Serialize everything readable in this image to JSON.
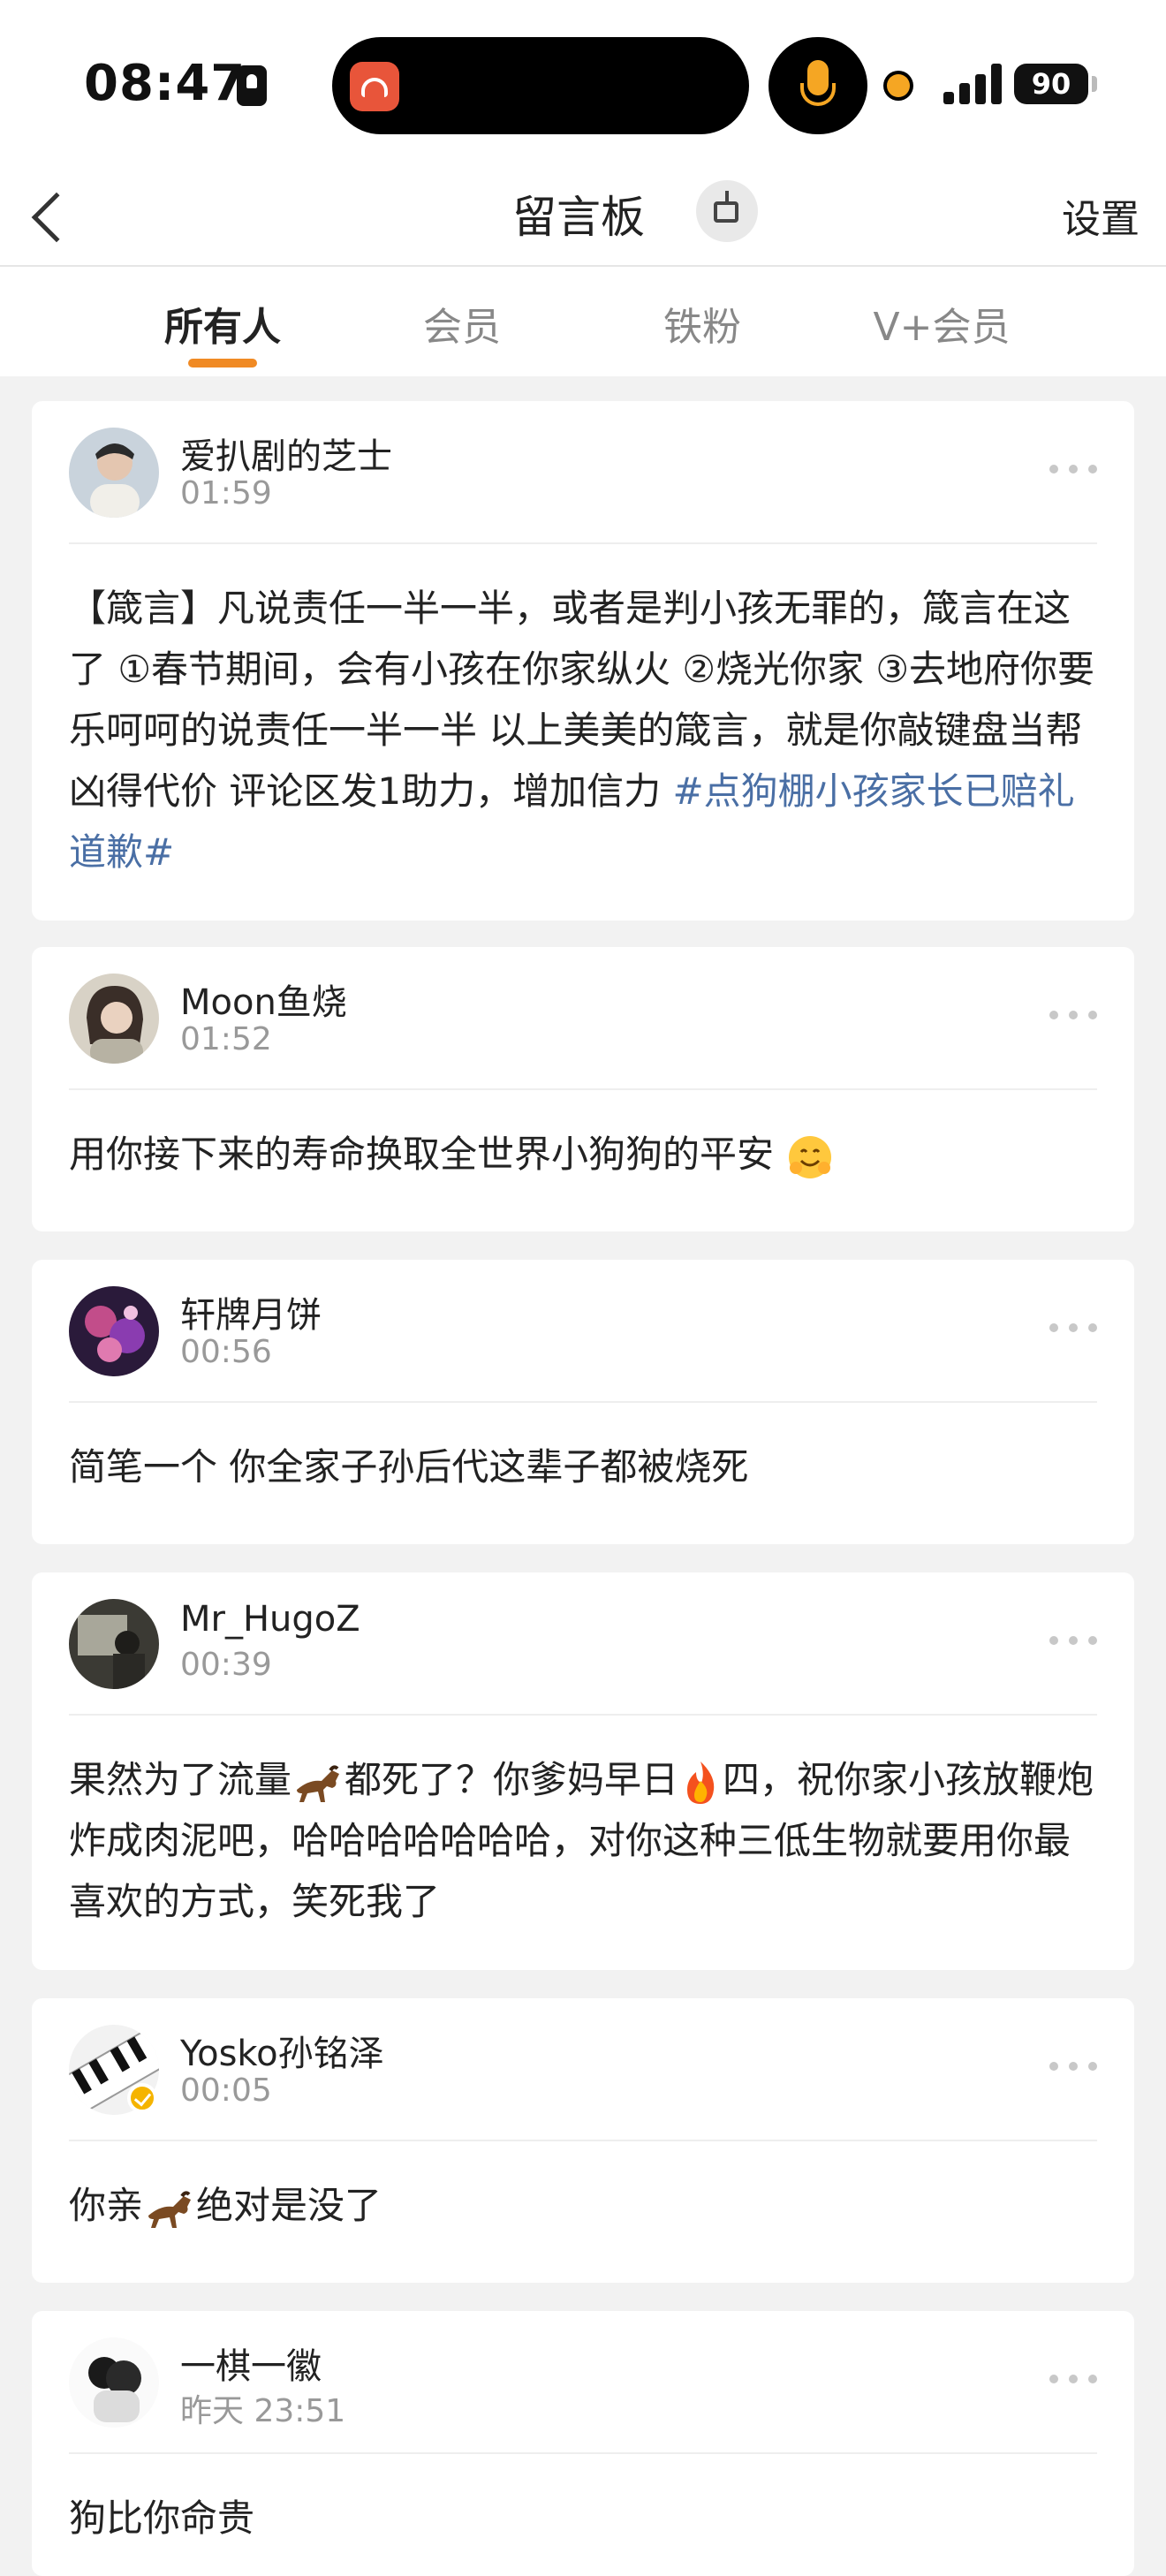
{
  "status_bar": {
    "time": "08:47",
    "battery": "90",
    "icons": [
      "lock-icon",
      "app-icon",
      "mic-icon",
      "recording-dot-icon",
      "signal-icon",
      "battery-icon"
    ]
  },
  "nav": {
    "title": "留言板",
    "settings_label": "设置",
    "icons": [
      "back-icon",
      "broom-icon"
    ]
  },
  "tabs": [
    {
      "label": "所有人",
      "active": true
    },
    {
      "label": "会员",
      "active": false
    },
    {
      "label": "铁粉",
      "active": false
    },
    {
      "label": "V+会员",
      "active": false
    }
  ],
  "colors": {
    "accent": "#f08a24",
    "hashtag": "#4a6fa5",
    "background": "#f2f2f2"
  },
  "comments": [
    {
      "username": "爱扒剧的芝士",
      "time": "01:59",
      "text": "【箴言】凡说责任一半一半，或者是判小孩无罪的，箴言在这了 ①春节期间，会有小孩在你家纵火 ②烧光你家 ③去地府你要乐呵呵的说责任一半一半 以上美美的箴言，就是你敲键盘当帮凶得代价 评论区发1助力，增加信力 ",
      "hashtag": "#点狗棚小孩家长已赔礼道歉#"
    },
    {
      "username": "Moon鱼烧",
      "time": "01:52",
      "text": "用你接下来的寿命换取全世界小狗狗的平安",
      "emoji": "hugging-face-emoji"
    },
    {
      "username": "轩牌月饼",
      "time": "00:56",
      "text": "简笔一个 你全家子孙后代这辈子都被烧死"
    },
    {
      "username": "Mr_HugoZ",
      "time": "00:39",
      "text_part1": "果然为了流量",
      "text_part2": "都死了？你爹妈早日",
      "text_part3": "四，祝你家小孩放鞭炮炸成肉泥吧，哈哈哈哈哈哈哈，对你这种三低生物就要用你最喜欢的方式，笑死我了",
      "emojis": [
        "horse-emoji",
        "fire-emoji"
      ]
    },
    {
      "username": "Yosko孙铭泽",
      "time": "00:05",
      "text_part1": "你亲",
      "text_part2": "绝对是没了",
      "emojis": [
        "horse-emoji"
      ],
      "verified": true
    },
    {
      "username": "一棋一徽",
      "time": "昨天 23:51",
      "text": "狗比你命贵"
    }
  ]
}
